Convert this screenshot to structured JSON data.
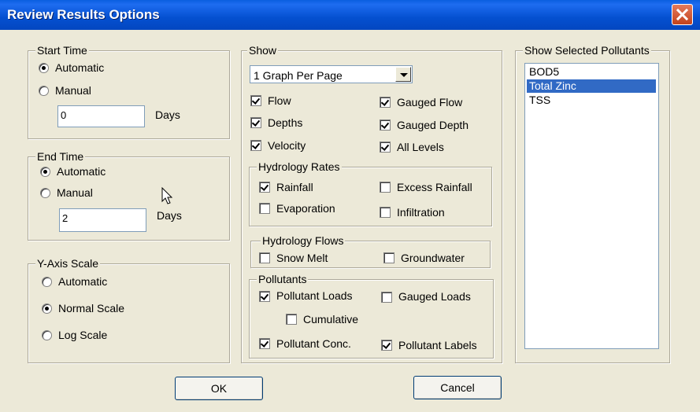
{
  "window": {
    "title": "Review Results Options"
  },
  "start_time": {
    "legend": "Start Time",
    "automatic": "Automatic",
    "manual": "Manual",
    "days_value": "0",
    "days_label": "Days",
    "selected": "automatic"
  },
  "end_time": {
    "legend": "End Time",
    "automatic": "Automatic",
    "manual": "Manual",
    "days_value": "2",
    "days_label": "Days",
    "selected": "automatic"
  },
  "y_axis": {
    "legend": "Y-Axis Scale",
    "automatic": "Automatic",
    "normal": "Normal Scale",
    "log": "Log Scale",
    "selected": "normal"
  },
  "show": {
    "legend": "Show",
    "graph_mode": "1 Graph Per Page",
    "flow": {
      "label": "Flow",
      "checked": true
    },
    "depths": {
      "label": "Depths",
      "checked": true
    },
    "velocity": {
      "label": "Velocity",
      "checked": true
    },
    "gauged_flow": {
      "label": "Gauged Flow",
      "checked": true
    },
    "gauged_depth": {
      "label": "Gauged Depth",
      "checked": true
    },
    "all_levels": {
      "label": "All Levels",
      "checked": true
    }
  },
  "hydrology_rates": {
    "legend": "Hydrology Rates",
    "rainfall": {
      "label": "Rainfall",
      "checked": true
    },
    "evaporation": {
      "label": "Evaporation",
      "checked": false
    },
    "excess_rainfall": {
      "label": "Excess Rainfall",
      "checked": false
    },
    "infiltration": {
      "label": "Infiltration",
      "checked": false
    }
  },
  "hydrology_flows": {
    "legend": "Hydrology Flows",
    "snow_melt": {
      "label": "Snow Melt",
      "checked": false
    },
    "groundwater": {
      "label": "Groundwater",
      "checked": false
    }
  },
  "pollutants": {
    "legend": "Pollutants",
    "pollutant_loads": {
      "label": "Pollutant Loads",
      "checked": true
    },
    "gauged_loads": {
      "label": "Gauged Loads",
      "checked": false
    },
    "cumulative": {
      "label": "Cumulative",
      "checked": false
    },
    "pollutant_conc": {
      "label": "Pollutant Conc.",
      "checked": true
    },
    "pollutant_labels": {
      "label": "Pollutant Labels",
      "checked": true
    }
  },
  "selected_pollutants": {
    "legend": "Show Selected Pollutants",
    "items": [
      "BOD5",
      "Total Zinc",
      "TSS"
    ],
    "selected_index": 1
  },
  "buttons": {
    "ok": "OK",
    "cancel": "Cancel"
  },
  "icons": {
    "close": "close-icon",
    "dropdown": "chevron-down-icon",
    "cursor": "mouse-pointer-icon"
  },
  "colors": {
    "titlebar": "#0450d0",
    "selection": "#316ac5",
    "close_button": "#c3431c"
  }
}
